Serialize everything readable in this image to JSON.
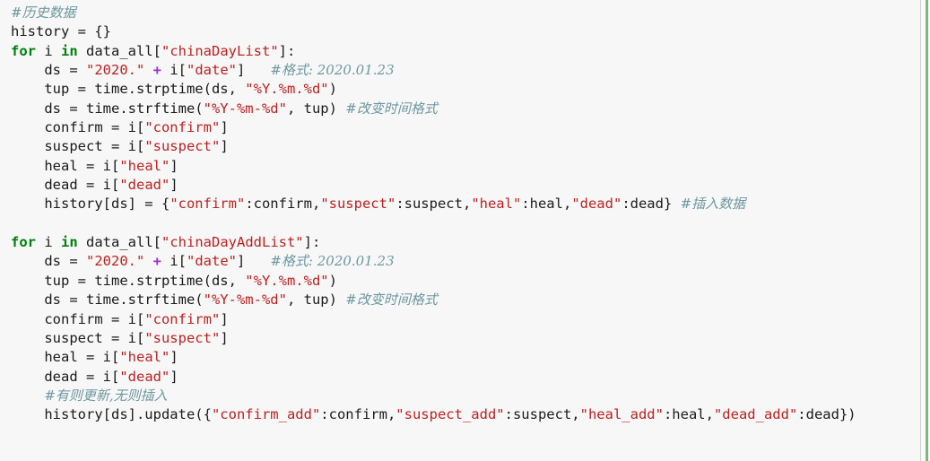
{
  "editor": {
    "language": "python",
    "background_color": "#f7f7f7",
    "text_color": "#1a1a1a",
    "keyword_color": "#007f0e",
    "string_color": "#ba2121",
    "operator_color": "#9b30d9",
    "comment_color": "#6d97a0",
    "right_rule_color": "#79bd7e",
    "right_divider_color": "#d0d0d0",
    "lines": [
      {
        "index": 1,
        "text": "#历史数据",
        "tokens": [
          {
            "t": "#历史数据",
            "k": "comment"
          }
        ]
      },
      {
        "index": 2,
        "text": "history = {}",
        "tokens": [
          {
            "t": "history = {}",
            "k": "plain"
          }
        ]
      },
      {
        "index": 3,
        "text": "for i in data_all[\"chinaDayList\"]:",
        "tokens": [
          {
            "t": "for",
            "k": "kw"
          },
          {
            "t": " i ",
            "k": "plain"
          },
          {
            "t": "in",
            "k": "kw"
          },
          {
            "t": " data_all[",
            "k": "plain"
          },
          {
            "t": "\"chinaDayList\"",
            "k": "str"
          },
          {
            "t": "]:",
            "k": "plain"
          }
        ]
      },
      {
        "index": 4,
        "text": "    ds = \"2020.\" + i[\"date\"]   #格式: 2020.01.23",
        "tokens": [
          {
            "t": "    ds = ",
            "k": "plain"
          },
          {
            "t": "\"2020.\"",
            "k": "str"
          },
          {
            "t": " ",
            "k": "plain"
          },
          {
            "t": "+",
            "k": "op"
          },
          {
            "t": " i[",
            "k": "plain"
          },
          {
            "t": "\"date\"",
            "k": "str"
          },
          {
            "t": "]   ",
            "k": "plain"
          },
          {
            "t": "#格式: 2020.01.23",
            "k": "comment"
          }
        ]
      },
      {
        "index": 5,
        "text": "    tup = time.strptime(ds, \"%Y.%m.%d\")",
        "tokens": [
          {
            "t": "    tup = time.strptime(ds, ",
            "k": "plain"
          },
          {
            "t": "\"%Y.%m.%d\"",
            "k": "str"
          },
          {
            "t": ")",
            "k": "plain"
          }
        ]
      },
      {
        "index": 6,
        "text": "    ds = time.strftime(\"%Y-%m-%d\", tup) #改变时间格式",
        "tokens": [
          {
            "t": "    ds = time.strftime(",
            "k": "plain"
          },
          {
            "t": "\"%Y-%m-%d\"",
            "k": "str"
          },
          {
            "t": ", tup) ",
            "k": "plain"
          },
          {
            "t": "#改变时间格式",
            "k": "comment"
          }
        ]
      },
      {
        "index": 7,
        "text": "    confirm = i[\"confirm\"]",
        "tokens": [
          {
            "t": "    confirm = i[",
            "k": "plain"
          },
          {
            "t": "\"confirm\"",
            "k": "str"
          },
          {
            "t": "]",
            "k": "plain"
          }
        ]
      },
      {
        "index": 8,
        "text": "    suspect = i[\"suspect\"]",
        "tokens": [
          {
            "t": "    suspect = i[",
            "k": "plain"
          },
          {
            "t": "\"suspect\"",
            "k": "str"
          },
          {
            "t": "]",
            "k": "plain"
          }
        ]
      },
      {
        "index": 9,
        "text": "    heal = i[\"heal\"]",
        "tokens": [
          {
            "t": "    heal = i[",
            "k": "plain"
          },
          {
            "t": "\"heal\"",
            "k": "str"
          },
          {
            "t": "]",
            "k": "plain"
          }
        ]
      },
      {
        "index": 10,
        "text": "    dead = i[\"dead\"]",
        "tokens": [
          {
            "t": "    dead = i[",
            "k": "plain"
          },
          {
            "t": "\"dead\"",
            "k": "str"
          },
          {
            "t": "]",
            "k": "plain"
          }
        ]
      },
      {
        "index": 11,
        "text": "    history[ds] = {\"confirm\":confirm,\"suspect\":suspect,\"heal\":heal,\"dead\":dead} #插入数据",
        "tokens": [
          {
            "t": "    history[ds] = {",
            "k": "plain"
          },
          {
            "t": "\"confirm\"",
            "k": "str"
          },
          {
            "t": ":confirm,",
            "k": "plain"
          },
          {
            "t": "\"suspect\"",
            "k": "str"
          },
          {
            "t": ":suspect,",
            "k": "plain"
          },
          {
            "t": "\"heal\"",
            "k": "str"
          },
          {
            "t": ":heal,",
            "k": "plain"
          },
          {
            "t": "\"dead\"",
            "k": "str"
          },
          {
            "t": ":dead} ",
            "k": "plain"
          },
          {
            "t": "#插入数据",
            "k": "comment"
          }
        ]
      },
      {
        "index": 12,
        "text": "",
        "tokens": []
      },
      {
        "index": 13,
        "text": "for i in data_all[\"chinaDayAddList\"]:",
        "tokens": [
          {
            "t": "for",
            "k": "kw"
          },
          {
            "t": " i ",
            "k": "plain"
          },
          {
            "t": "in",
            "k": "kw"
          },
          {
            "t": " data_all[",
            "k": "plain"
          },
          {
            "t": "\"chinaDayAddList\"",
            "k": "str"
          },
          {
            "t": "]:",
            "k": "plain"
          }
        ]
      },
      {
        "index": 14,
        "text": "    ds = \"2020.\" + i[\"date\"]   #格式: 2020.01.23",
        "tokens": [
          {
            "t": "    ds = ",
            "k": "plain"
          },
          {
            "t": "\"2020.\"",
            "k": "str"
          },
          {
            "t": " ",
            "k": "plain"
          },
          {
            "t": "+",
            "k": "op"
          },
          {
            "t": " i[",
            "k": "plain"
          },
          {
            "t": "\"date\"",
            "k": "str"
          },
          {
            "t": "]   ",
            "k": "plain"
          },
          {
            "t": "#格式: 2020.01.23",
            "k": "comment"
          }
        ]
      },
      {
        "index": 15,
        "text": "    tup = time.strptime(ds, \"%Y.%m.%d\")",
        "tokens": [
          {
            "t": "    tup = time.strptime(ds, ",
            "k": "plain"
          },
          {
            "t": "\"%Y.%m.%d\"",
            "k": "str"
          },
          {
            "t": ")",
            "k": "plain"
          }
        ]
      },
      {
        "index": 16,
        "text": "    ds = time.strftime(\"%Y-%m-%d\", tup) #改变时间格式",
        "tokens": [
          {
            "t": "    ds = time.strftime(",
            "k": "plain"
          },
          {
            "t": "\"%Y-%m-%d\"",
            "k": "str"
          },
          {
            "t": ", tup) ",
            "k": "plain"
          },
          {
            "t": "#改变时间格式",
            "k": "comment"
          }
        ]
      },
      {
        "index": 17,
        "text": "    confirm = i[\"confirm\"]",
        "tokens": [
          {
            "t": "    confirm = i[",
            "k": "plain"
          },
          {
            "t": "\"confirm\"",
            "k": "str"
          },
          {
            "t": "]",
            "k": "plain"
          }
        ]
      },
      {
        "index": 18,
        "text": "    suspect = i[\"suspect\"]",
        "tokens": [
          {
            "t": "    suspect = i[",
            "k": "plain"
          },
          {
            "t": "\"suspect\"",
            "k": "str"
          },
          {
            "t": "]",
            "k": "plain"
          }
        ]
      },
      {
        "index": 19,
        "text": "    heal = i[\"heal\"]",
        "tokens": [
          {
            "t": "    heal = i[",
            "k": "plain"
          },
          {
            "t": "\"heal\"",
            "k": "str"
          },
          {
            "t": "]",
            "k": "plain"
          }
        ]
      },
      {
        "index": 20,
        "text": "    dead = i[\"dead\"]",
        "tokens": [
          {
            "t": "    dead = i[",
            "k": "plain"
          },
          {
            "t": "\"dead\"",
            "k": "str"
          },
          {
            "t": "]",
            "k": "plain"
          }
        ]
      },
      {
        "index": 21,
        "text": "    #有则更新,无则插入",
        "tokens": [
          {
            "t": "    ",
            "k": "plain"
          },
          {
            "t": "#有则更新,无则插入",
            "k": "comment"
          }
        ]
      },
      {
        "index": 22,
        "text": "    history[ds].update({\"confirm_add\":confirm,\"suspect_add\":suspect,\"heal_add\":heal,\"dead_add\":dead})",
        "tokens": [
          {
            "t": "    history[ds].update({",
            "k": "plain"
          },
          {
            "t": "\"confirm_add\"",
            "k": "str"
          },
          {
            "t": ":confirm,",
            "k": "plain"
          },
          {
            "t": "\"suspect_add\"",
            "k": "str"
          },
          {
            "t": ":suspect,",
            "k": "plain"
          },
          {
            "t": "\"heal_add\"",
            "k": "str"
          },
          {
            "t": ":heal,",
            "k": "plain"
          },
          {
            "t": "\"dead_add\"",
            "k": "str"
          },
          {
            "t": ":dead})",
            "k": "plain"
          }
        ]
      }
    ]
  }
}
